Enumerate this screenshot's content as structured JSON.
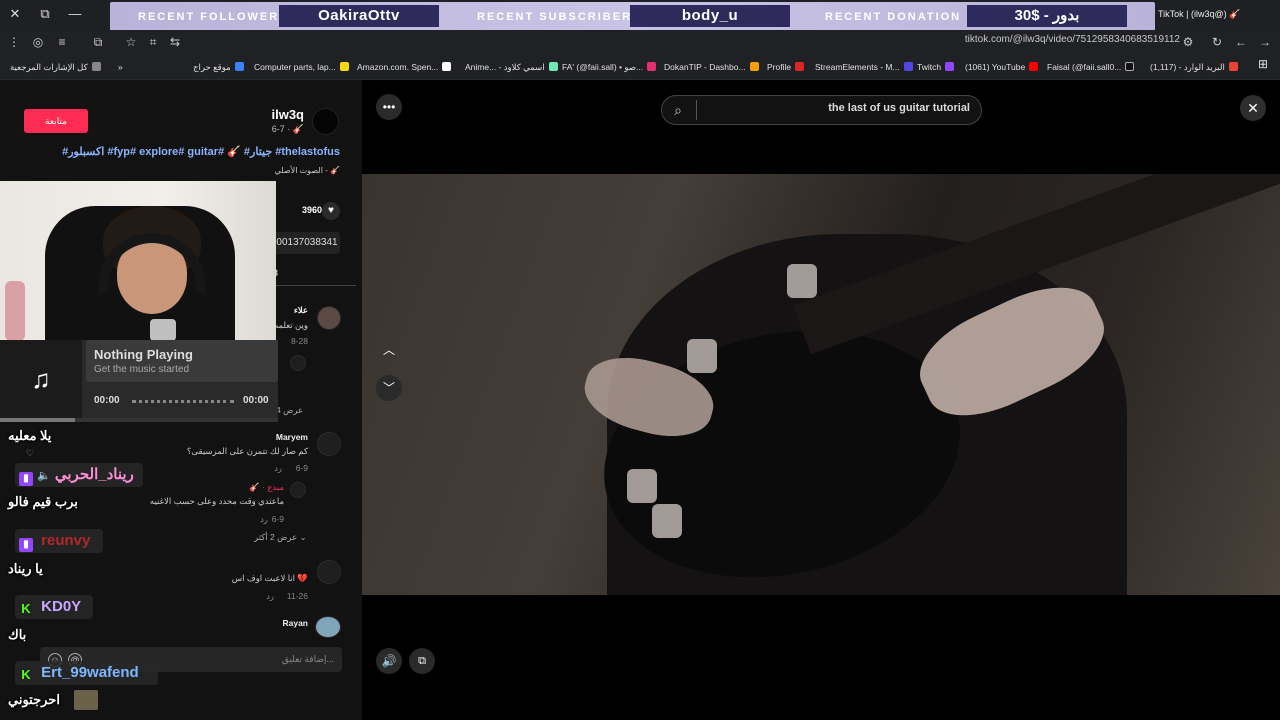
{
  "stream_overlay": {
    "follower_label": "RECENT FOLLOWER",
    "follower_value": "OakiraOttv",
    "subscriber_label": "RECENT SUBSCRIBER",
    "subscriber_value": "body_u",
    "donation_label": "RECENT DONATION",
    "donation_value": "30$ - بدور"
  },
  "browser": {
    "tab_title": "TikTok | (ilw3q@) 🎸",
    "url": "tiktok.com/@ilw3q/video/7512958340683519112",
    "bookmarks": [
      "كل الإشارات المرجعية",
      "موقع حراج",
      "Computer parts, lap...",
      "Amazon.com. Spen...",
      "Anime... - اسمي كلاود",
      "FA' (@faii.sall) • صو...",
      "DokanTIP - Dashbo...",
      "Profile",
      "StreamElements - M...",
      "Twitch",
      "(1061) YouTube",
      "Faisal (@faii.sall0...",
      "البريد الوارد - (1,117)"
    ]
  },
  "post": {
    "follow_label": "متابعة",
    "author": "ilw3q",
    "date": "6-7 · 🎸",
    "caption": "#اكسبلور #fyp# explore# guitar# 🎸 #جيتار #thelastofus",
    "sound": "الصوت الأصلي - 🎸",
    "likes": "3960",
    "link": "00137038341",
    "comments_tab": "(3"
  },
  "comments": [
    {
      "user": "علاء",
      "text": "وين تعلمت",
      "date": "8-28"
    },
    {
      "user": "Maryem",
      "text": "كم صار لك تتمرن على المرسيقى؟",
      "date": "6-9",
      "reply": "رد"
    },
    {
      "user": "",
      "text": "ماعتدي وقت محدد وعلى حسب الاغنيه",
      "date": "6-9",
      "reply": "رد",
      "tag": "🎸 · مبدع"
    },
    {
      "user": "",
      "text": "انا لاعبت اوف اس 💔",
      "date": "11-26",
      "reply": "رد"
    },
    {
      "user": "Rayan",
      "text": "",
      "date": ""
    }
  ],
  "more_replies": "عرض 2 أكثر",
  "more_replies_1": "عرض 4",
  "add_comment_placeholder": "إضافة تعليق...",
  "now_playing": {
    "title": "Nothing Playing",
    "subtitle": "Get the music started",
    "time_start": "00:00",
    "time_end": "00:00",
    "progress": 0.27
  },
  "chat": [
    {
      "text": "يلا معليه"
    },
    {
      "user": "ريناد_الحربي",
      "platform": "twitch",
      "color": "#ff8fd6"
    },
    {
      "text": "برب قيم فالو"
    },
    {
      "user": "reunvy",
      "platform": "twitch",
      "color": "#b0282c"
    },
    {
      "text": "يا ريناد"
    },
    {
      "user": "KD0Y",
      "platform": "kick",
      "color": "#c9a6ff"
    },
    {
      "text": "باك"
    },
    {
      "user": "Ert_99wafend",
      "platform": "kick",
      "color": "#7fb7ff"
    },
    {
      "text": "احرجتوني"
    }
  ],
  "search": {
    "query": "the last of us guitar tutorial"
  },
  "icons": {
    "more": "more-icon",
    "close": "close-icon",
    "up": "chevron-up-icon",
    "down": "chevron-down-icon",
    "volume": "volume-icon",
    "pip": "pip-icon"
  },
  "colors": {
    "follow_button": "#fe2c55",
    "overlay_bar": "#c9c3e6",
    "overlay_box": "#2f2a5c"
  }
}
